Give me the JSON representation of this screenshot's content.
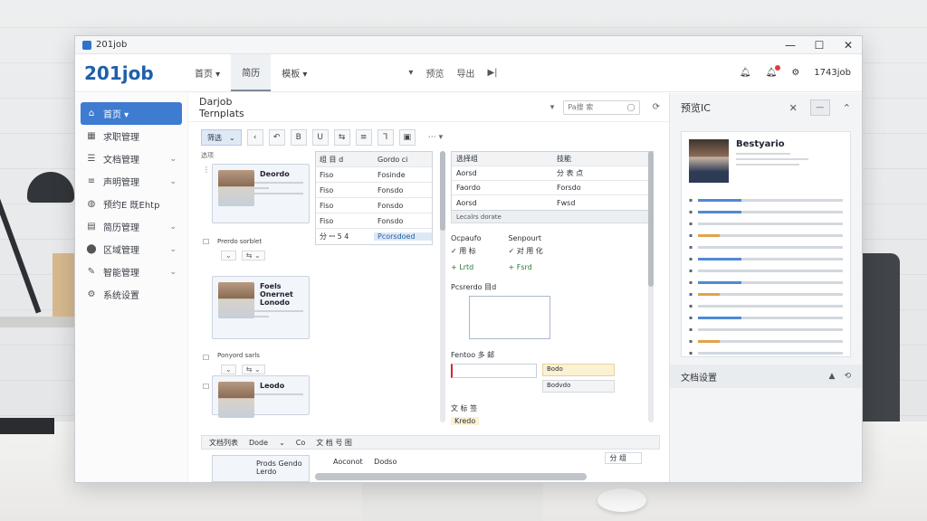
{
  "window": {
    "title": "201job"
  },
  "brand": {
    "name": "201job"
  },
  "topnav": {
    "items": [
      {
        "label": "首页 ▾"
      },
      {
        "label": "简历"
      },
      {
        "label": "模板 ▾"
      }
    ],
    "tools": [
      "▾",
      "预览",
      "导出",
      "▶|"
    ],
    "user": "1743job"
  },
  "sidebar": {
    "items": [
      {
        "icon": "home-icon",
        "label": "首页 ▾",
        "active": true
      },
      {
        "icon": "grid-icon",
        "label": "求职管理"
      },
      {
        "icon": "list-icon",
        "label": "文档管理"
      },
      {
        "icon": "menu-icon",
        "label": "声明管理"
      },
      {
        "icon": "globe-icon",
        "label": "预约E 既Ehtp"
      },
      {
        "icon": "doc-icon",
        "label": "简历管理"
      },
      {
        "icon": "pin-icon",
        "label": "区域管理"
      },
      {
        "icon": "tool-icon",
        "label": "智能管理"
      },
      {
        "icon": "gear-icon",
        "label": "系统设置"
      }
    ]
  },
  "main": {
    "title": "Darjob Ternplats",
    "search_placeholder": "Pa搜 索",
    "toolbar": {
      "select": "筛选",
      "more": "⋯ ▾"
    },
    "list_label": "选项",
    "cards": [
      {
        "name": "Deordo",
        "meta": "Prerdo sorblet"
      },
      {
        "name": "Foels Onernet Lonodo",
        "meta": "Ponyord sarls"
      },
      {
        "name": "Leodo",
        "meta": ""
      }
    ],
    "grid": {
      "rows": [
        [
          "组 目 d",
          "Gordo ci"
        ],
        [
          "Fiso",
          "Fosinde"
        ],
        [
          "Fiso",
          "Fonsdo"
        ],
        [
          "Fiso",
          "Fonsdo"
        ],
        [
          "Fiso",
          "Fonsdo"
        ],
        [
          "分 ꟷ 5 4",
          "Pcorsdoed"
        ]
      ]
    },
    "right_table": {
      "head": [
        "选择组",
        "技能"
      ],
      "rows": [
        [
          "Aorsd",
          "分 表 点"
        ],
        [
          "Faordo",
          "Forsdo"
        ],
        [
          "Aorsd",
          "Fwsd"
        ]
      ],
      "status": "Lecalrs dorate"
    },
    "right_sections": {
      "a_left": "Ocpaufo",
      "a_right": "Senpourt",
      "a_tag1": "用 标",
      "a_tag2": "对 用 化",
      "a_ok1": "Lrtd",
      "a_ok2": "Fsrd",
      "field_label": "Pcsrerdo 目d",
      "field2_label": "Fentoo 多 邮",
      "tag_yellow": "Bodo",
      "tag_grey": "Bodvdo",
      "sec3": "文 标 签",
      "sec3_tag": "Kredo"
    },
    "bottom": {
      "label": "文档列表",
      "tabs": [
        "Dode",
        "Co",
        "文 档 号 图"
      ],
      "card_name": "Prods Gendo Lerdo",
      "item": "Aoconot",
      "item2": "Dodso",
      "right": "分 组"
    }
  },
  "preview": {
    "title": "预览IC",
    "resume_name": "Bestyario",
    "footer": "文档设置"
  }
}
